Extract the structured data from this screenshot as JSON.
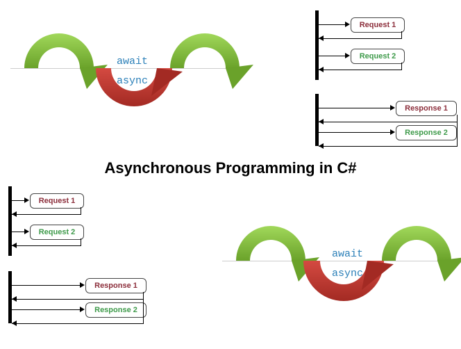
{
  "title": "Asynchronous Programming in C#",
  "keywords": {
    "await": "await",
    "async": "async"
  },
  "labels": {
    "request1": "Request 1",
    "request2": "Request 2",
    "response1": "Response 1",
    "response2": "Response 2"
  },
  "colors": {
    "green": "#8cc63f",
    "red": "#c1352d",
    "blue_text": "#2a7fb8"
  }
}
